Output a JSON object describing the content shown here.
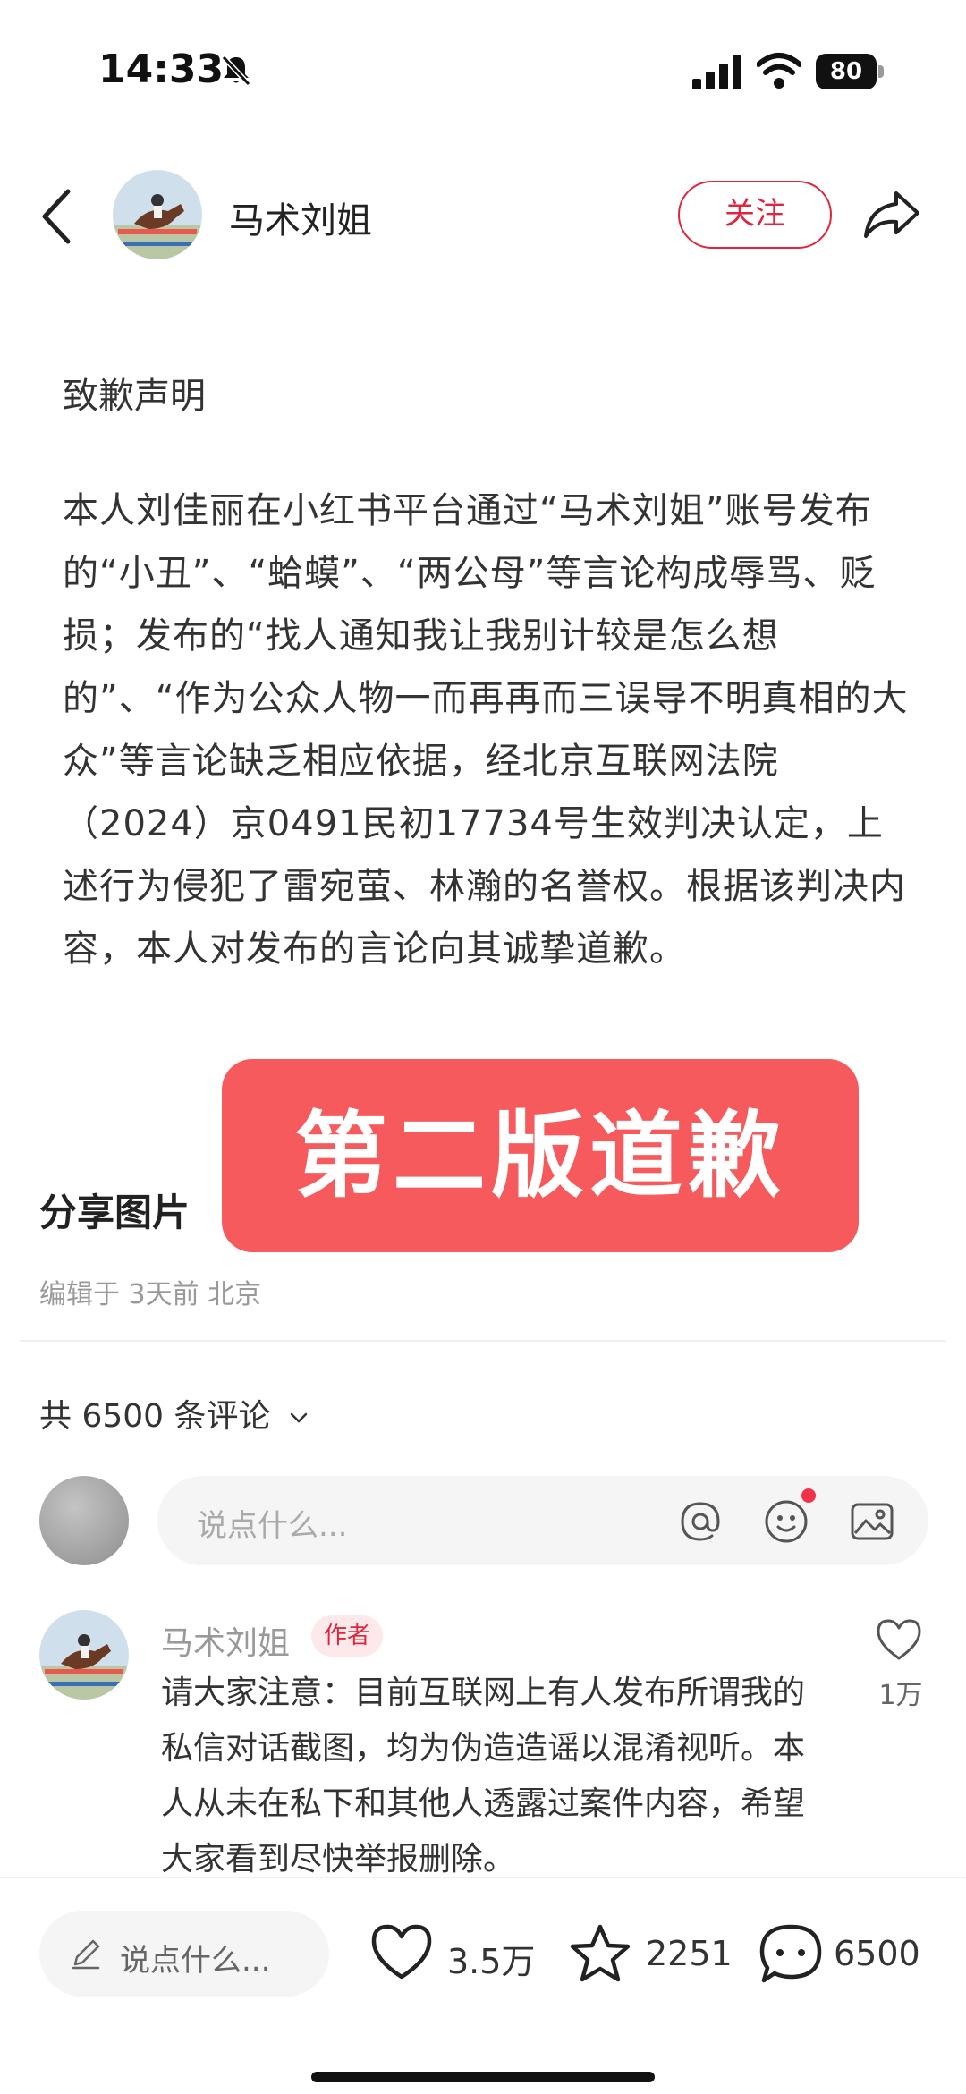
{
  "status_bar": {
    "time": "14:33",
    "battery": "80"
  },
  "header": {
    "author_name": "马术刘姐",
    "follow_label": "关注"
  },
  "article": {
    "title": "致歉声明",
    "body": "本人刘佳丽在小红书平台通过“马术刘姐”账号发布的“小丑”、“蛤蟆”、“两公母”等言论构成辱骂、贬损；发布的“找人通知我让我别计较是怎么想的”、“作为公众人物一而再再而三误导不明真相的大众”等言论缺乏相应依据，经北京互联网法院（2024）京0491民初17734号生效判决认定，上述行为侵犯了雷宛萤、林瀚的名誉权。根据该判决内容，本人对发布的言论向其诚挚道歉。",
    "overlay_text": "第二版道歉",
    "share_label": "分享图片",
    "edit_info": "编辑于 3天前 北京"
  },
  "comments": {
    "count_label": "共 6500 条评论",
    "input_placeholder": "说点什么...",
    "items": [
      {
        "author": "马术刘姐",
        "badge": "作者",
        "text": "请大家注意：目前互联网上有人发布所谓我的私信对话截图，均为伪造造谣以混淆视听。本人从未在私下和其他人透露过案件内容，希望大家看到尽快举报删除。",
        "likes": "1万"
      }
    ]
  },
  "bottom_bar": {
    "input_placeholder": "说点什么...",
    "likes": "3.5万",
    "stars": "2251",
    "comments": "6500"
  },
  "colors": {
    "accent": "#e0263f",
    "overlay": "#f65a5c"
  }
}
